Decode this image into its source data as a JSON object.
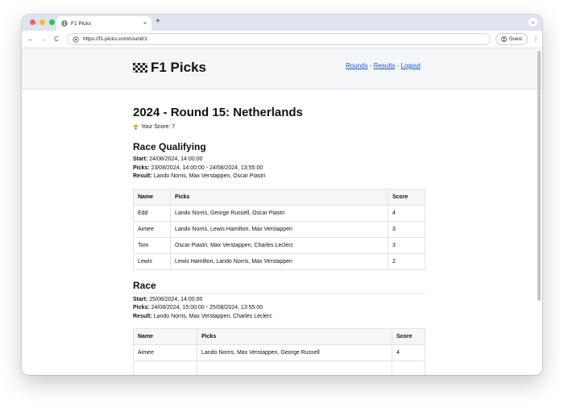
{
  "browser": {
    "tab_title": "F1 Picks",
    "tab_close": "×",
    "new_tab": "+",
    "url": "https://f1-picks.com/round/1",
    "profile_label": "Guest",
    "back": "←",
    "forward": "→",
    "reload": "C",
    "menu": "⋮",
    "tab_menu": "⌄"
  },
  "site": {
    "logo_text": "F1 Picks",
    "nav": {
      "rounds": "Rounds",
      "results": "Results",
      "logout": "Logout",
      "separator": " - "
    }
  },
  "round": {
    "title": "2024 - Round 15: Netherlands",
    "score_text": "Your Score: 7"
  },
  "labels": {
    "start": "Start:",
    "picks": "Picks:",
    "result": "Result:"
  },
  "table_headers": [
    "Name",
    "Picks",
    "Score"
  ],
  "qualifying": {
    "title": "Race Qualifying",
    "start": "24/08/2024, 14:00:00",
    "picks": "23/08/2024, 14:00:00 - 24/08/2024, 13:55:00",
    "result": "Lando Norris, Max Verstappen, Oscar Piastri",
    "rows": [
      {
        "name": "Edd",
        "picks": "Lando Norris, George Russell, Oscar Piastri",
        "score": "4"
      },
      {
        "name": "Aimee",
        "picks": "Lando Norris, Lewis Hamilton, Max Verstappen",
        "score": "3"
      },
      {
        "name": "Tom",
        "picks": "Oscar Piastri, Max Verstappen, Charles Leclerc",
        "score": "3"
      },
      {
        "name": "Lewis",
        "picks": "Lewis Hamilton, Lando Norris, Max Verstappen",
        "score": "2"
      }
    ]
  },
  "race": {
    "title": "Race",
    "start": "25/08/2024, 14:00:00",
    "picks": "24/08/2024, 15:00:00 - 25/08/2024, 13:55:00",
    "result": "Lando Norris, Max Verstappen, Charles Leclerc",
    "rows": [
      {
        "name": "Aimee",
        "picks": "Lando Norris, Max Verstappen, George Russell",
        "score": "4"
      }
    ]
  }
}
